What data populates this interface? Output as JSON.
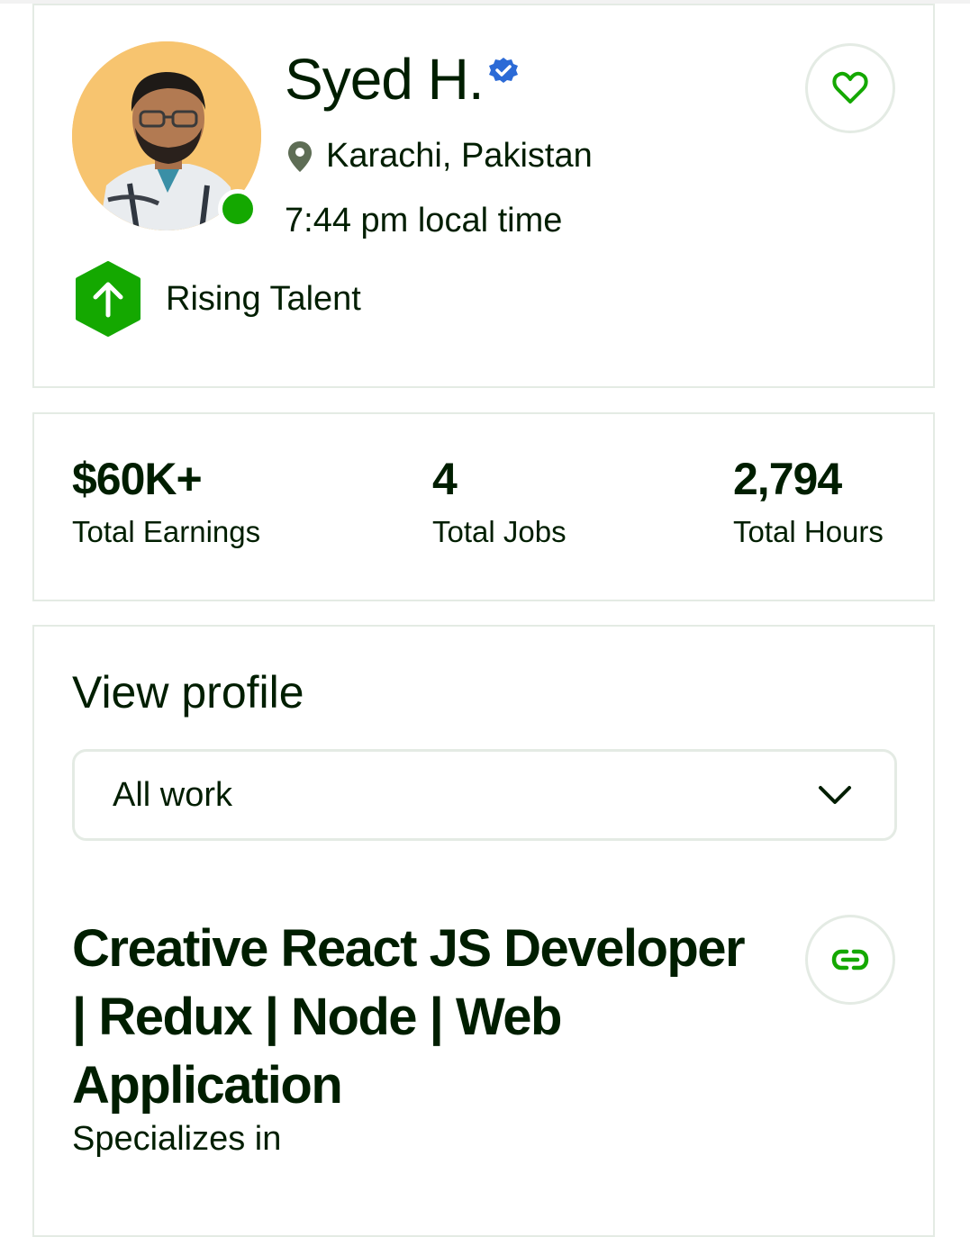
{
  "profile": {
    "name": "Syed H.",
    "verified": true,
    "location": "Karachi, Pakistan",
    "local_time": "7:44 pm local time",
    "online": true,
    "badge": {
      "label": "Rising Talent",
      "icon": "arrow-up-hexagon-icon"
    }
  },
  "stats": [
    {
      "value": "$60K+",
      "label": "Total Earnings"
    },
    {
      "value": "4",
      "label": "Total Jobs"
    },
    {
      "value": "2,794",
      "label": "Total Hours"
    }
  ],
  "view_profile": {
    "heading": "View profile",
    "selected_option": "All work"
  },
  "specialized_profile": {
    "title": "Creative React JS Developer | Redux | Node | Web Application",
    "subtitle": "Specializes in"
  },
  "colors": {
    "accent_green": "#14a800",
    "text_dark": "#001e00",
    "border": "#e4ebe4",
    "verified_blue": "#2b6ad6"
  }
}
